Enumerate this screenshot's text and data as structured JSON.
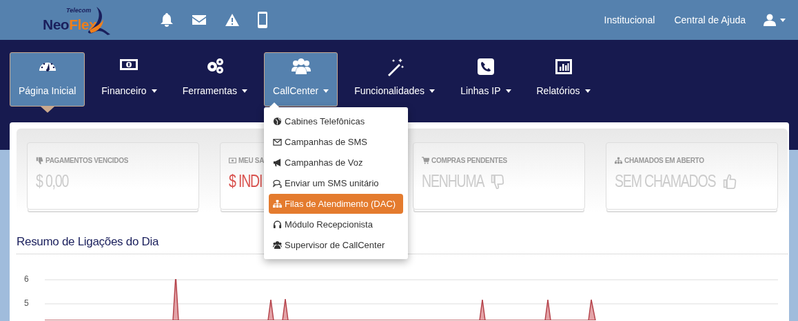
{
  "header": {
    "logo": {
      "tagline": "Telecom",
      "name_part_1": "Neo",
      "name_part_2": "Flex"
    },
    "links": [
      "Institucional",
      "Central de Ajuda"
    ]
  },
  "nav": {
    "items": [
      {
        "label": "Página Inicial",
        "selected": true,
        "open": false,
        "dropdown": false
      },
      {
        "label": "Financeiro",
        "selected": false,
        "open": false,
        "dropdown": true
      },
      {
        "label": "Ferramentas",
        "selected": false,
        "open": false,
        "dropdown": true
      },
      {
        "label": "CallCenter",
        "selected": false,
        "open": true,
        "dropdown": true
      },
      {
        "label": "Funcionalidades",
        "selected": false,
        "open": false,
        "dropdown": true
      },
      {
        "label": "Linhas IP",
        "selected": false,
        "open": false,
        "dropdown": true
      },
      {
        "label": "Relatórios",
        "selected": false,
        "open": false,
        "dropdown": true
      }
    ]
  },
  "menu": {
    "items": [
      {
        "label": "Cabines Telefônicas",
        "selected": false
      },
      {
        "label": "Campanhas de SMS",
        "selected": false
      },
      {
        "label": "Campanhas de Voz",
        "selected": false
      },
      {
        "label": "Enviar um SMS unitário",
        "selected": false
      },
      {
        "label": "Filas de Atendimento (DAC)",
        "selected": true
      },
      {
        "label": "Módulo Recepcionista",
        "selected": false
      },
      {
        "label": "Supervisor de CallCenter",
        "selected": false
      }
    ]
  },
  "stats": [
    {
      "title": "PAGAMENTOS VENCIDOS",
      "value": "$ 0,00",
      "color": "#cccccc"
    },
    {
      "title": "MEU SA",
      "value": "$ INDI",
      "color": "#d9534f"
    },
    {
      "title": "COMPRAS PENDENTES",
      "value": "NENHUMA",
      "color": "#cccccc"
    },
    {
      "title": "CHAMADOS EM ABERTO",
      "value": "SEM CHAMADOS",
      "color": "#cccccc"
    }
  ],
  "chart": {
    "title": "Resumo de Ligações do Dia",
    "tick_labels": [
      "6",
      "5"
    ]
  }
}
